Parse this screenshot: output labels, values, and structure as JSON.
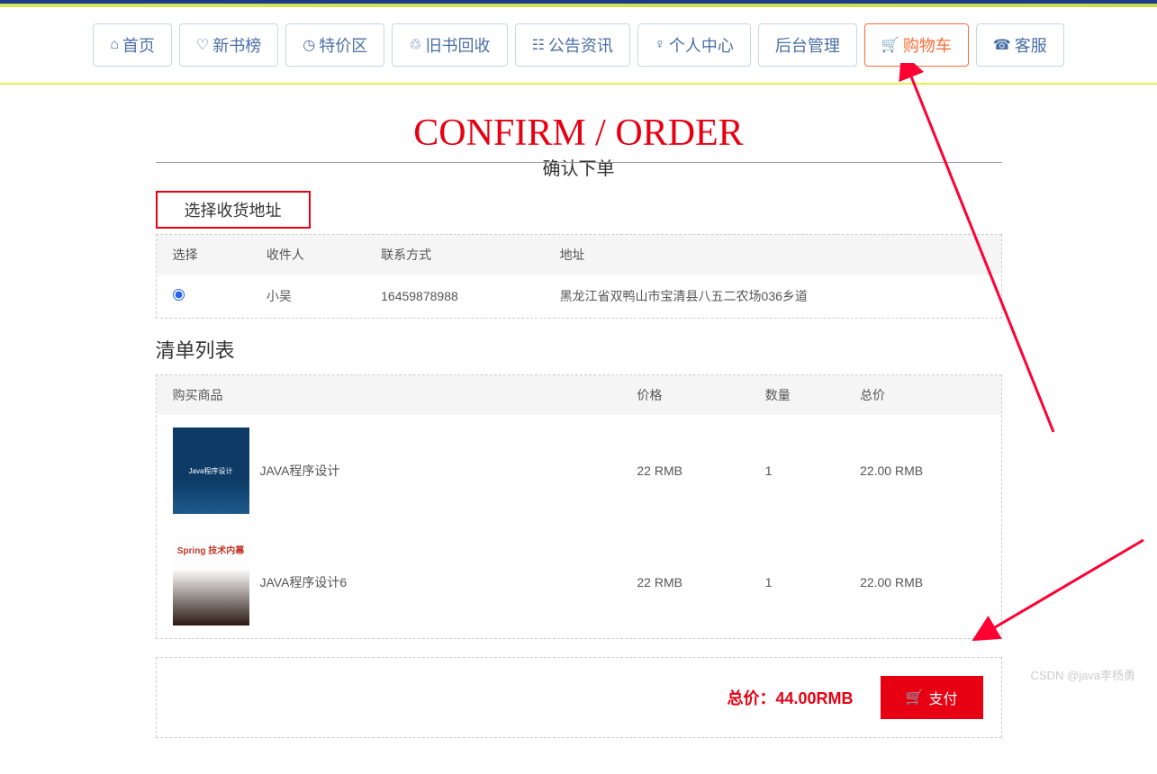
{
  "nav": {
    "home": "首页",
    "newbooks": "新书榜",
    "special": "特价区",
    "recycle": "旧书回收",
    "news": "公告资讯",
    "personal": "个人中心",
    "admin": "后台管理",
    "cart": "购物车",
    "service": "客服"
  },
  "page": {
    "title_en": "CONFIRM / ORDER",
    "title_cn": "确认下单",
    "address_section": "选择收货地址",
    "list_section": "清单列表"
  },
  "address_headers": {
    "select": "选择",
    "recipient": "收件人",
    "contact": "联系方式",
    "address": "地址"
  },
  "addresses": [
    {
      "recipient": "小吴",
      "contact": "16459878988",
      "address": "黑龙江省双鸭山市宝清县八五二农场036乡道",
      "selected": true
    }
  ],
  "item_headers": {
    "product": "购买商品",
    "price": "价格",
    "qty": "数量",
    "total": "总价"
  },
  "items": [
    {
      "name": "JAVA程序设计",
      "price": "22 RMB",
      "qty": "1",
      "total": "22.00 RMB"
    },
    {
      "name": "JAVA程序设计6",
      "price": "22 RMB",
      "qty": "1",
      "total": "22.00 RMB"
    }
  ],
  "summary": {
    "total_label": "总价：",
    "total_value": "44.00RMB",
    "pay_label": "支付"
  },
  "watermark": "CSDN @java李杨勇"
}
